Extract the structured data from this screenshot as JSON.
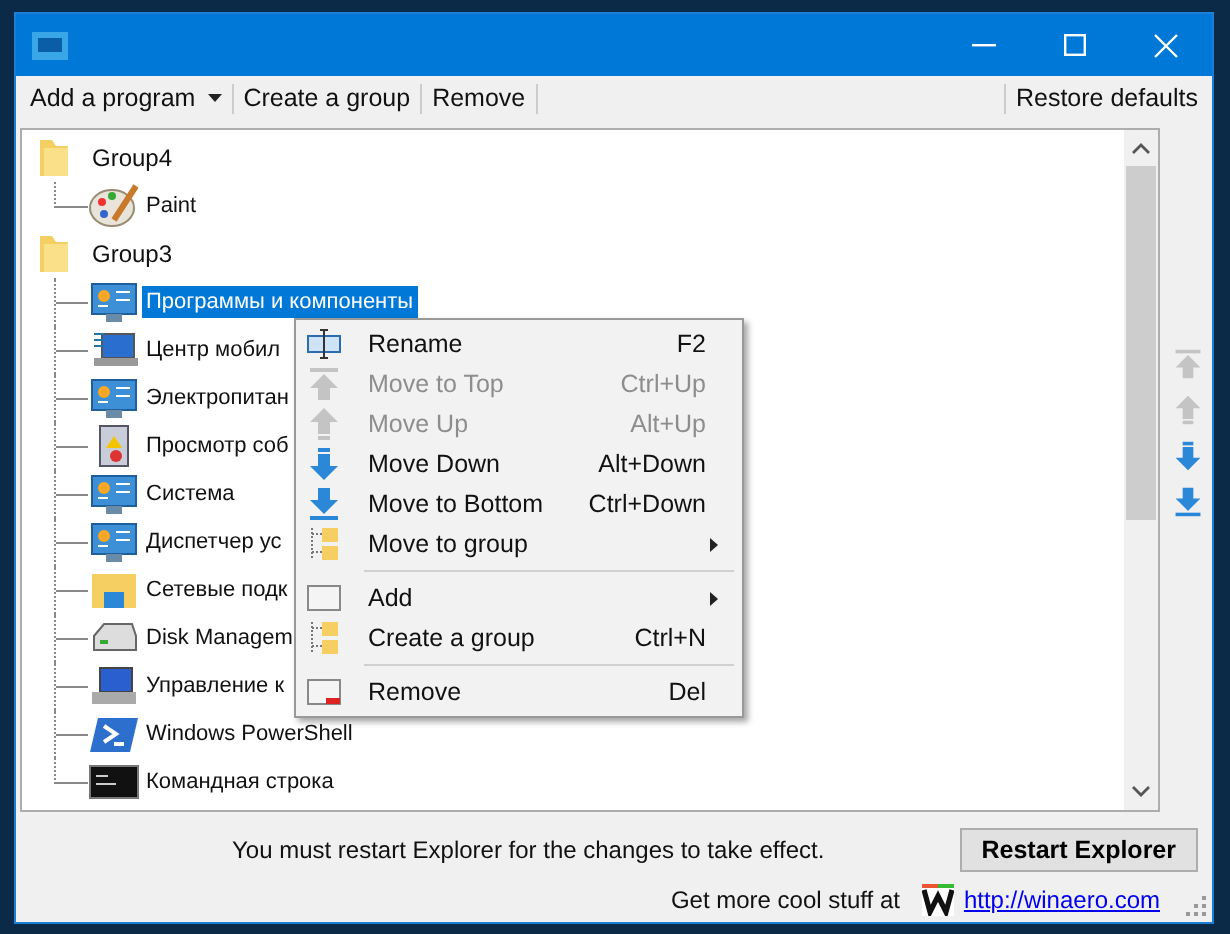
{
  "toolbar": {
    "left": [
      {
        "label": "Add a program",
        "dropdown": true
      },
      {
        "label": "Create a group",
        "dropdown": false
      },
      {
        "label": "Remove",
        "dropdown": false
      }
    ],
    "right": "Restore defaults"
  },
  "tree": [
    {
      "label": "Group4",
      "children": [
        {
          "label": "Paint",
          "kind": "paint",
          "selected": false
        }
      ]
    },
    {
      "label": "Group3",
      "children": [
        {
          "label": "Программы и компоненты",
          "kind": "panel",
          "selected": true
        },
        {
          "label": "Центр мобил",
          "kind": "mobility",
          "selected": false
        },
        {
          "label": "Электропитан",
          "kind": "panel",
          "selected": false
        },
        {
          "label": "Просмотр соб",
          "kind": "event",
          "selected": false
        },
        {
          "label": "Система",
          "kind": "panel",
          "selected": false
        },
        {
          "label": "Диспетчер ус",
          "kind": "panel",
          "selected": false
        },
        {
          "label": "Сетевые подк",
          "kind": "netfolder",
          "selected": false
        },
        {
          "label": "Disk Managem",
          "kind": "disk",
          "selected": false
        },
        {
          "label": "Управление к",
          "kind": "computer",
          "selected": false
        },
        {
          "label": "Windows PowerShell",
          "kind": "powershell",
          "selected": false
        },
        {
          "label": "Командная строка",
          "kind": "cmd",
          "selected": false
        }
      ]
    }
  ],
  "context_menu": [
    {
      "kind": "rename",
      "label": "Rename",
      "shortcut": "F2",
      "disabled": false,
      "submenu": false
    },
    {
      "kind": "top",
      "label": "Move to Top",
      "shortcut": "Ctrl+Up",
      "disabled": true,
      "submenu": false
    },
    {
      "kind": "up",
      "label": "Move Up",
      "shortcut": "Alt+Up",
      "disabled": true,
      "submenu": false
    },
    {
      "kind": "down",
      "label": "Move Down",
      "shortcut": "Alt+Down",
      "disabled": false,
      "submenu": false
    },
    {
      "kind": "bottom",
      "label": "Move to Bottom",
      "shortcut": "Ctrl+Down",
      "disabled": false,
      "submenu": false
    },
    {
      "kind": "group",
      "label": "Move to group",
      "disabled": false,
      "submenu": true
    },
    {
      "kind": "separator"
    },
    {
      "kind": "add",
      "label": "Add",
      "disabled": false,
      "submenu": true
    },
    {
      "kind": "group",
      "label": "Create a group",
      "shortcut": "Ctrl+N",
      "disabled": false,
      "submenu": false
    },
    {
      "kind": "separator"
    },
    {
      "kind": "remove",
      "label": "Remove",
      "shortcut": "Del",
      "disabled": false,
      "submenu": false
    }
  ],
  "side_buttons": [
    {
      "kind": "top",
      "disabled": true
    },
    {
      "kind": "up",
      "disabled": true
    },
    {
      "kind": "down",
      "disabled": false
    },
    {
      "kind": "bottom",
      "disabled": false
    }
  ],
  "restart_note": "You must restart Explorer for the changes to take effect.",
  "restart_button": "Restart Explorer",
  "footer": {
    "text": "Get more cool stuff at",
    "link": "http://winaero.com"
  }
}
